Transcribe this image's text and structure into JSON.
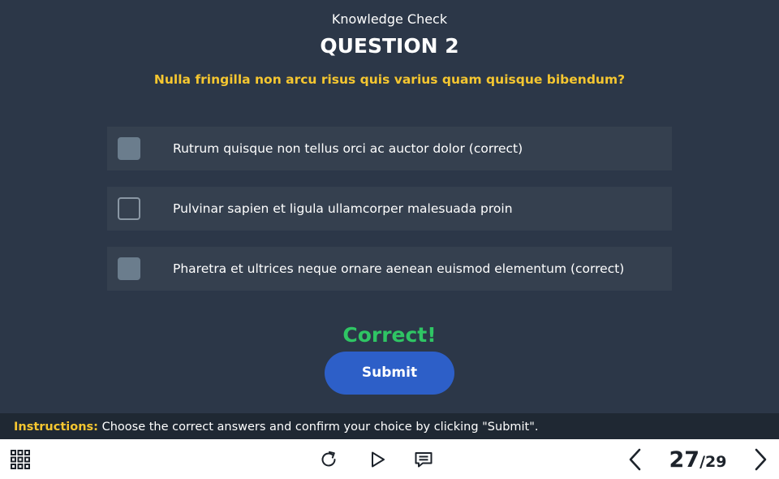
{
  "header": {
    "section_label": "Knowledge Check",
    "question_title": "QUESTION 2",
    "question_text": "Nulla fringilla non arcu risus quis varius quam quisque bibendum?"
  },
  "options": [
    {
      "label": "Rutrum quisque non tellus orci ac auctor dolor (correct)",
      "checked": true
    },
    {
      "label": "Pulvinar sapien et ligula ullamcorper malesuada proin",
      "checked": false
    },
    {
      "label": "Pharetra et ultrices neque ornare aenean euismod elementum (correct)",
      "checked": true
    }
  ],
  "feedback": "Correct!",
  "submit_label": "Submit",
  "instructions": {
    "key": "Instructions:",
    "text": " Choose the correct answers and confirm your choice by clicking \"Submit\"."
  },
  "toolbar": {
    "current_page": "27",
    "total_pages": "/29",
    "icons": [
      "menu-grid-icon",
      "replay-icon",
      "play-icon",
      "notes-icon",
      "chevron-left-icon",
      "chevron-right-icon"
    ]
  },
  "colors": {
    "background": "#2c3748",
    "option_bg": "#35404f",
    "accent_yellow": "#f5c630",
    "correct_green": "#2fc564",
    "submit_blue": "#2d5fc8"
  }
}
